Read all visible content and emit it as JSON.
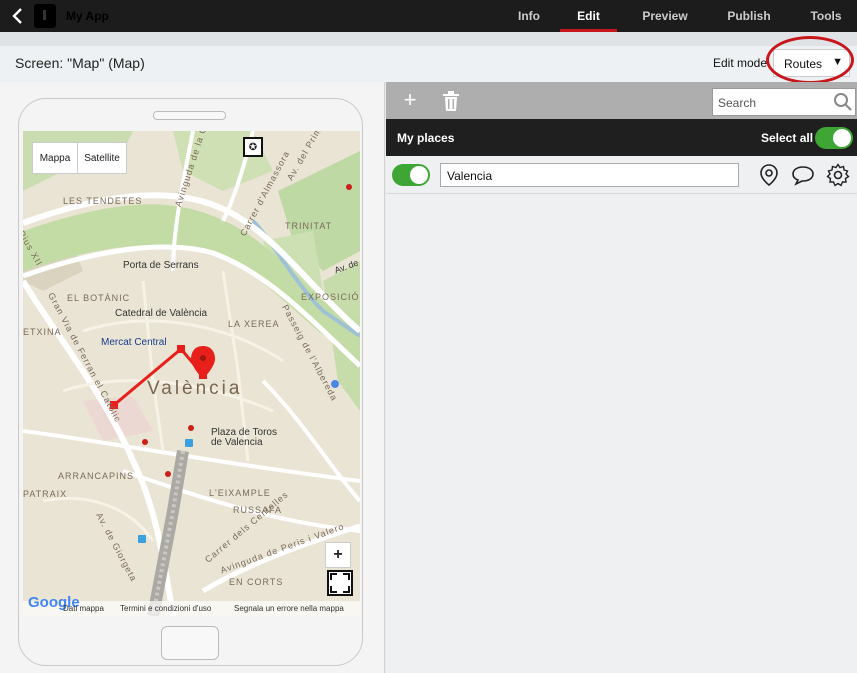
{
  "topbar": {
    "back_icon": "chevron-left-icon",
    "app_title": "My App",
    "tabs": [
      {
        "label": "Info",
        "active": false
      },
      {
        "label": "Edit",
        "active": true
      },
      {
        "label": "Preview",
        "active": false
      },
      {
        "label": "Publish",
        "active": false
      },
      {
        "label": "Tools",
        "active": false
      }
    ],
    "accent_color": "#c8171c"
  },
  "subbar": {
    "screen_label": "Screen: \"Map\" (Map)",
    "edit_mode_label": "Edit mode",
    "edit_mode_value": "Routes"
  },
  "map": {
    "type_buttons": [
      "Mappa",
      "Satellite"
    ],
    "labels": {
      "les_tendetes": "LES TENDETES",
      "trinitat": "TRINITAT",
      "porta_serrans": "Porta de Serrans",
      "el_botanic": "EL BOTÀNIC",
      "exposicio": "EXPOSICIÓ",
      "catedral": "Catedral de València",
      "la_xerea": "LA XEREA",
      "etxina": "ETXINA",
      "mercat": "Mercat Central",
      "valencia": "València",
      "plaza_toros_1": "Plaza de Toros",
      "plaza_toros_2": "de Valencia",
      "arrancapins": "ARRANCAPINS",
      "patraix": "PATRAIX",
      "eixample": "L'EIXAMPLE",
      "russafa": "RUSSAFA",
      "en_corts": "EN CORTS",
      "av_constitucion": "Avinguda de la Constitució",
      "primat_reig": "Av. del Primat Reig",
      "carrer_almassora": "Carrer d'Almassora",
      "gran_via": "Gran Via de Ferran el Catòlic",
      "passeig_albereda": "Passeig de l'Albereda",
      "av_giorgeta": "Av. de Giorgeta",
      "carrer_centelles": "Carrer dels Centelles",
      "avinguda_peris": "Avinguda de Peris i Valero",
      "pius_xii": "Pius XII",
      "av_de": "Av. de"
    },
    "footer": {
      "google": "Google",
      "dati": "Dati mappa",
      "termini": "Termini e condizioni d'uso",
      "segnala": "Segnala un errore nella mappa"
    },
    "zoom_in": "+",
    "route_color": "#e8201c"
  },
  "places_panel": {
    "search_placeholder": "Search",
    "title": "My places",
    "select_all_label": "Select all",
    "select_all_on": true,
    "toggle_color": "#3fa535",
    "places": [
      {
        "name": "Valencia",
        "enabled": true
      }
    ]
  }
}
